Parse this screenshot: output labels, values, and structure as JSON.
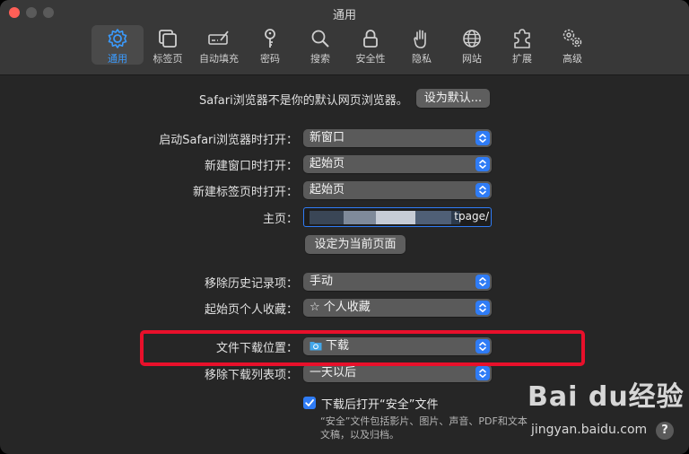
{
  "window": {
    "title": "通用"
  },
  "tabs": [
    {
      "id": "general",
      "label": "通用",
      "icon": "gear-icon",
      "active": true
    },
    {
      "id": "tabs",
      "label": "标签页",
      "icon": "tabs-icon",
      "active": false
    },
    {
      "id": "autofill",
      "label": "自动填充",
      "icon": "autofill-icon",
      "active": false
    },
    {
      "id": "passwords",
      "label": "密码",
      "icon": "key-icon",
      "active": false
    },
    {
      "id": "search",
      "label": "搜索",
      "icon": "search-icon",
      "active": false
    },
    {
      "id": "security",
      "label": "安全性",
      "icon": "lock-icon",
      "active": false
    },
    {
      "id": "privacy",
      "label": "隐私",
      "icon": "hand-icon",
      "active": false
    },
    {
      "id": "websites",
      "label": "网站",
      "icon": "globe-icon",
      "active": false
    },
    {
      "id": "extensions",
      "label": "扩展",
      "icon": "puzzle-icon",
      "active": false
    },
    {
      "id": "advanced",
      "label": "高级",
      "icon": "gears-icon",
      "active": false
    }
  ],
  "default_browser": {
    "text": "Safari浏览器不是你的默认网页浏览器。",
    "button": "设为默认..."
  },
  "settings": {
    "open_with_label": "启动Safari浏览器时打开：",
    "open_with_value": "新窗口",
    "new_window_label": "新建窗口时打开：",
    "new_window_value": "起始页",
    "new_tab_label": "新建标签页时打开：",
    "new_tab_value": "起始页",
    "homepage_label": "主页：",
    "homepage_value": "tpage/",
    "set_current_button": "设定为当前页面",
    "remove_history_label": "移除历史记录项：",
    "remove_history_value": "手动",
    "favorites_label": "起始页个人收藏：",
    "favorites_value": "☆ 个人收藏",
    "download_location_label": "文件下载位置：",
    "download_location_value": "下载",
    "remove_downloads_label": "移除下载列表项：",
    "remove_downloads_value": "一天以后"
  },
  "safe_files": {
    "checked": true,
    "label": "下载后打开“安全”文件",
    "note": "“安全”文件包括影片、图片、声音、PDF和文本文稿，以及归档。"
  },
  "watermark": {
    "logo": "Bai du经验",
    "url": "jingyan.baidu.com"
  },
  "help": "?",
  "colors": {
    "accent": "#2f7cf6",
    "highlight": "#e8102b",
    "tab_active_label": "#3a9bff"
  }
}
